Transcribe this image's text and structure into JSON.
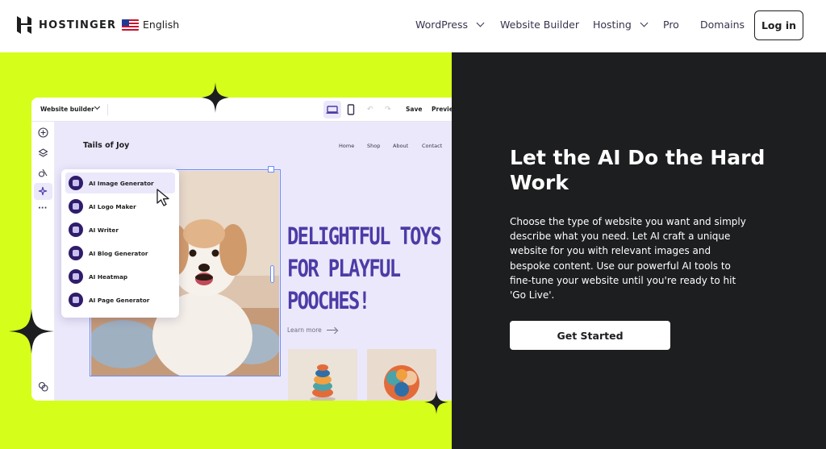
{
  "nav": {
    "brand": "HOSTINGER",
    "language": "English",
    "links": [
      {
        "label": "WordPress",
        "has_dropdown": true
      },
      {
        "label": "Website Builder",
        "has_dropdown": false
      },
      {
        "label": "Hosting",
        "has_dropdown": true
      },
      {
        "label": "Pro",
        "has_dropdown": false
      },
      {
        "label": "Domains",
        "has_dropdown": false
      }
    ],
    "login": "Log in"
  },
  "builder": {
    "dropdown_label": "Website builder",
    "save": "Save",
    "preview": "Previe",
    "site_title": "Tails of Joy",
    "site_nav": [
      "Home",
      "Shop",
      "About",
      "Contact"
    ],
    "headline_lines": [
      "DELIGHTFUL TOYS",
      "FOR PLAYFUL",
      "POOCHES!"
    ],
    "learn_more": "Learn more",
    "ai_menu": [
      {
        "label": "AI Image Generator",
        "active": true
      },
      {
        "label": "AI Logo Maker",
        "active": false
      },
      {
        "label": "AI Writer",
        "active": false
      },
      {
        "label": "AI Blog Generator",
        "active": false
      },
      {
        "label": "AI Heatmap",
        "active": false
      },
      {
        "label": "AI Page Generator",
        "active": false
      }
    ]
  },
  "hero": {
    "title": "Let the AI Do the Hard Work",
    "description": "Choose the type of website you want and simply describe what you need. Let AI craft a unique website for you with relevant images and bespoke content. Use our powerful AI tools to fine-tune your website until you're ready to hit 'Go Live'.",
    "cta": "Get Started"
  },
  "colors": {
    "lime": "#d5ff1a",
    "dark": "#1d1e20",
    "purple": "#4d3ba6",
    "canvas": "#ebe8fb"
  }
}
